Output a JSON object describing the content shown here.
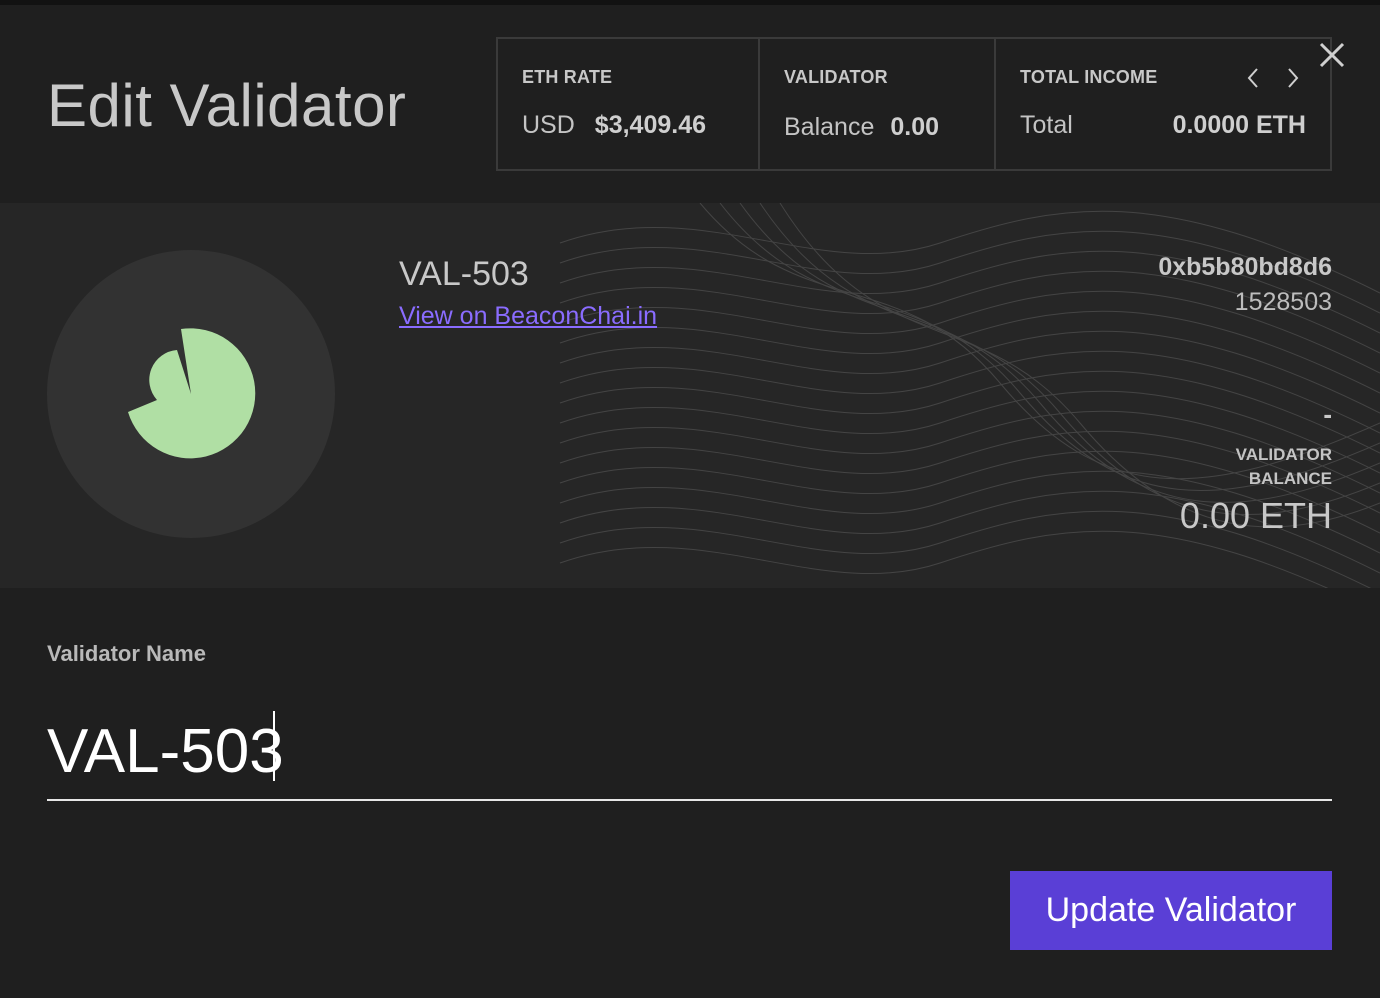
{
  "header": {
    "title": "Edit Validator"
  },
  "stats": {
    "eth_rate": {
      "label": "ETH RATE",
      "key": "USD",
      "value": "$3,409.46"
    },
    "validator": {
      "label": "VALIDATOR",
      "key": "Balance",
      "value": "0.00"
    },
    "total_income": {
      "label": "TOTAL INCOME",
      "key": "Total",
      "value": "0.0000 ETH"
    }
  },
  "icons": {
    "close": "close-icon",
    "prev": "chevron-left-icon",
    "next": "chevron-right-icon"
  },
  "validator_card": {
    "name": "VAL-503",
    "link_text": "View on BeaconChai.in",
    "address": "0xb5b80bd8d6",
    "index": "1528503",
    "dash": "-",
    "balance_label_line1": "VALIDATOR",
    "balance_label_line2": "BALANCE",
    "balance_value": "0.00 ETH",
    "avatar_color": "#b0dfa4"
  },
  "form": {
    "label": "Validator Name",
    "name_value": "VAL-503",
    "submit_label": "Update Validator"
  },
  "colors": {
    "accent": "#5a3fd6",
    "link": "#8a6cff",
    "background": "#1f1f1f"
  }
}
